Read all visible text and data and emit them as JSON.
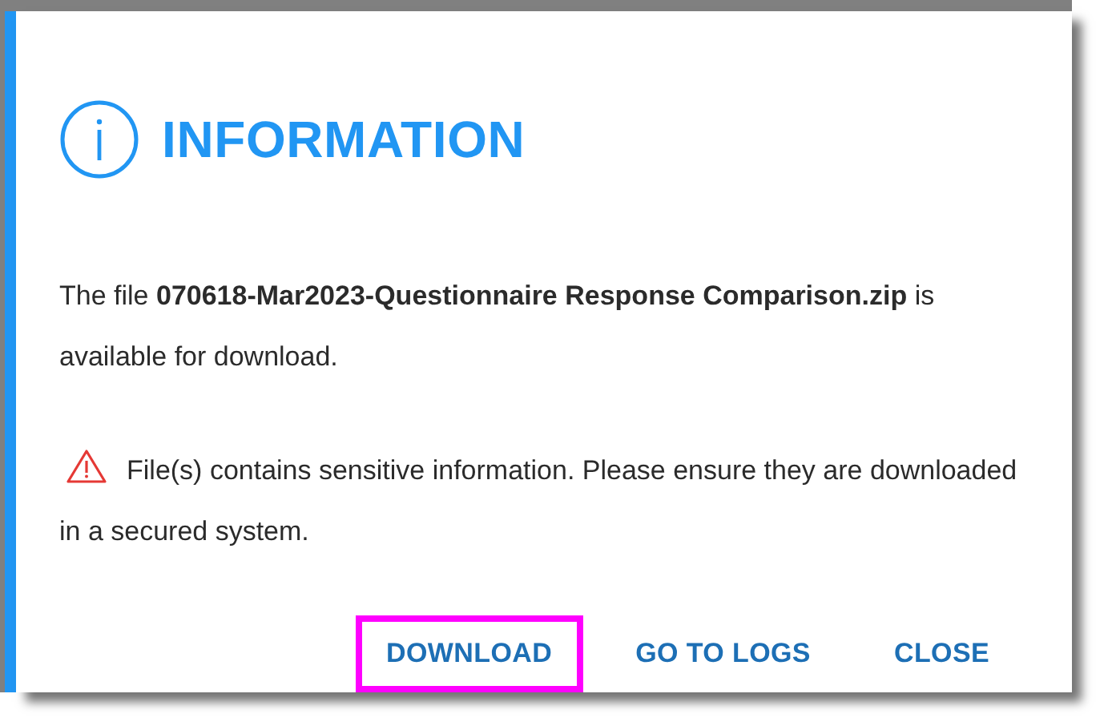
{
  "dialog": {
    "title": "INFORMATION",
    "message": "The file **070618-Mar2023-Questionnaire Response Comparison.zip** is available for download.",
    "warning": "File(s) contains sensitive information. Please ensure they are downloaded in a secured system.",
    "buttons": [
      {
        "label": "DOWNLOAD",
        "highlighted": true
      },
      {
        "label": "GO TO LOGS",
        "highlighted": false
      },
      {
        "label": "CLOSE",
        "highlighted": false
      }
    ]
  }
}
